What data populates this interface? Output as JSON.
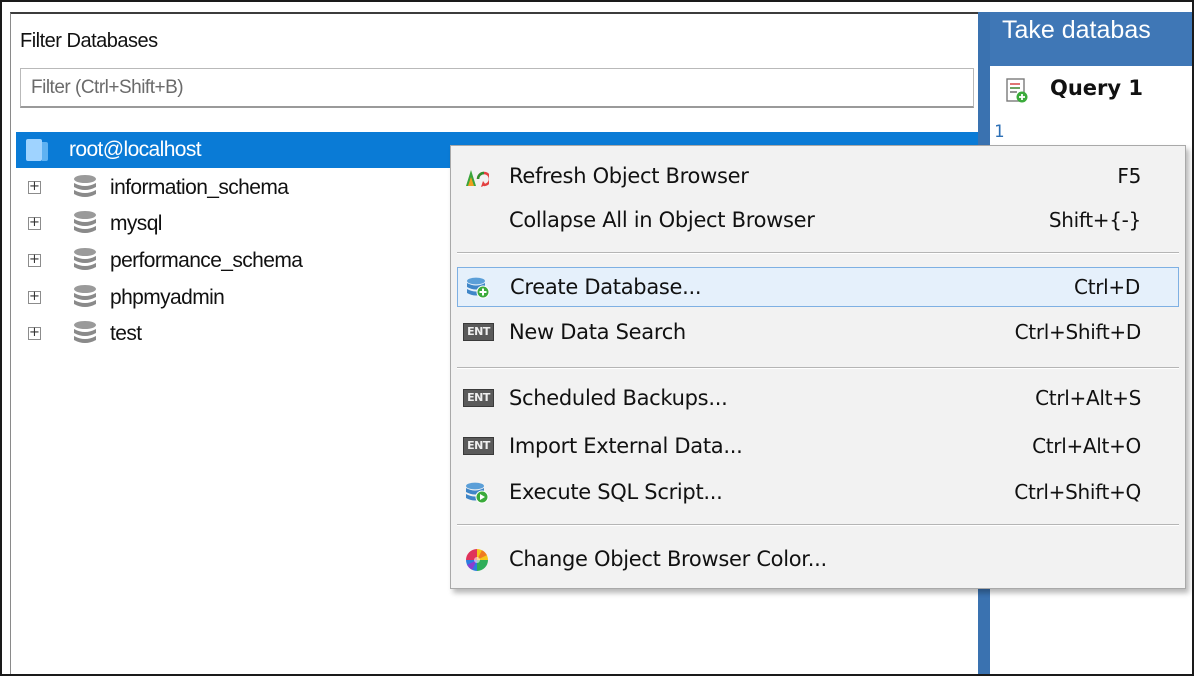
{
  "object_browser": {
    "filter_label": "Filter Databases",
    "filter_placeholder": "Filter (Ctrl+Shift+B)",
    "filter_value": "",
    "connection": "root@localhost",
    "databases": [
      {
        "name": "information_schema"
      },
      {
        "name": "mysql"
      },
      {
        "name": "performance_schema"
      },
      {
        "name": "phpmyadmin"
      },
      {
        "name": "test"
      }
    ]
  },
  "query_area": {
    "header_title": "Take databas",
    "tab_label": "Query 1",
    "line_number": "1"
  },
  "context_menu": {
    "items": [
      {
        "label": "Refresh Object Browser",
        "shortcut": "F5",
        "icon": "refresh-icon"
      },
      {
        "label": "Collapse All in Object Browser",
        "shortcut": "Shift+{-}",
        "icon": ""
      },
      {
        "label": "Create Database...",
        "shortcut": "Ctrl+D",
        "icon": "create-database-icon",
        "highlighted": true
      },
      {
        "label": "New Data Search",
        "shortcut": "Ctrl+Shift+D",
        "icon": "ent-badge-icon",
        "badge": "ENT"
      },
      {
        "label": "Scheduled Backups...",
        "shortcut": "Ctrl+Alt+S",
        "icon": "ent-badge-icon",
        "badge": "ENT"
      },
      {
        "label": "Import External Data...",
        "shortcut": "Ctrl+Alt+O",
        "icon": "ent-badge-icon",
        "badge": "ENT"
      },
      {
        "label": "Execute SQL Script...",
        "shortcut": "Ctrl+Shift+Q",
        "icon": "execute-script-icon"
      },
      {
        "label": "Change Object Browser Color...",
        "shortcut": "",
        "icon": "color-wheel-icon"
      }
    ]
  },
  "colors": {
    "selection_blue": "#0a7bd6",
    "header_blue": "#3f77b6",
    "menu_background": "#f2f2f2",
    "menu_highlight": "#e5f0fb",
    "menu_highlight_border": "#7eb0e3",
    "ent_badge": "#5a5a5a"
  }
}
